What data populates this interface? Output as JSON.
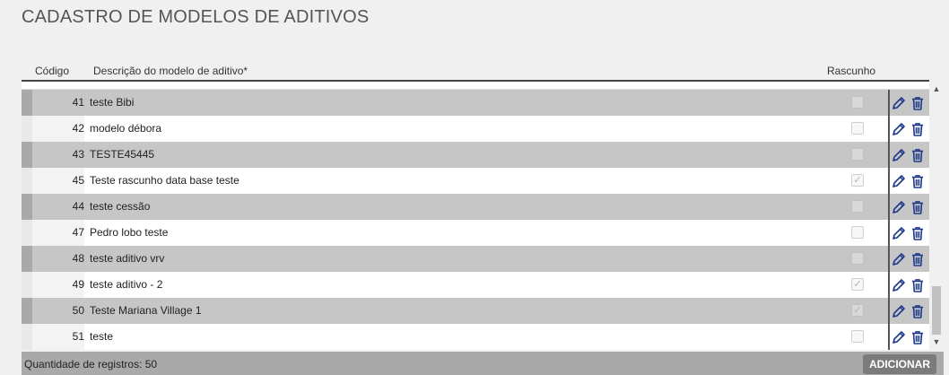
{
  "page": {
    "title": "CADASTRO DE MODELOS DE ADITIVOS"
  },
  "grid": {
    "columns": {
      "code": "Código",
      "description": "Descrição do modelo de aditivo*",
      "draft": "Rascunho"
    },
    "rows": [
      {
        "code": "41",
        "description": "teste Bibi",
        "draft": false
      },
      {
        "code": "42",
        "description": "modelo débora",
        "draft": false
      },
      {
        "code": "43",
        "description": "TESTE45445",
        "draft": false
      },
      {
        "code": "45",
        "description": "Teste rascunho data base teste",
        "draft": true
      },
      {
        "code": "44",
        "description": "teste cessão",
        "draft": false
      },
      {
        "code": "47",
        "description": "Pedro lobo teste",
        "draft": false
      },
      {
        "code": "48",
        "description": "teste aditivo vrv",
        "draft": false
      },
      {
        "code": "49",
        "description": "teste aditivo - 2",
        "draft": true
      },
      {
        "code": "50",
        "description": "Teste Mariana Village 1",
        "draft": true
      },
      {
        "code": "51",
        "description": "teste",
        "draft": false
      }
    ],
    "icons": {
      "edit": "pencil-icon",
      "delete": "trash-icon"
    },
    "icon_color": "#1f3a8a"
  },
  "footer": {
    "count_label": "Quantidade de registros: 50",
    "add_label": "ADICIONAR"
  }
}
